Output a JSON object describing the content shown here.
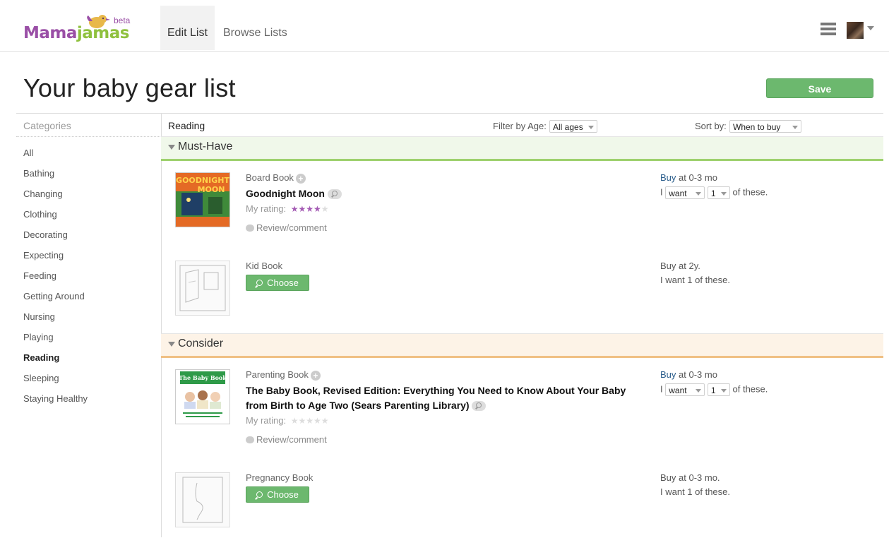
{
  "header": {
    "logo_text_a": "Mama",
    "logo_text_b": "jamas",
    "beta": "beta",
    "tabs": [
      {
        "label": "Edit List",
        "active": true
      },
      {
        "label": "Browse Lists",
        "active": false
      }
    ],
    "icons": {
      "menu": "hamburger-menu-icon",
      "avatar": "user-avatar",
      "dropdown": "caret-down-icon"
    }
  },
  "page": {
    "title": "Your baby gear list",
    "save_label": "Save"
  },
  "sidebar": {
    "heading": "Categories",
    "items": [
      {
        "label": "All",
        "active": false
      },
      {
        "label": "Bathing",
        "active": false
      },
      {
        "label": "Changing",
        "active": false
      },
      {
        "label": "Clothing",
        "active": false
      },
      {
        "label": "Decorating",
        "active": false
      },
      {
        "label": "Expecting",
        "active": false
      },
      {
        "label": "Feeding",
        "active": false
      },
      {
        "label": "Getting Around",
        "active": false
      },
      {
        "label": "Nursing",
        "active": false
      },
      {
        "label": "Playing",
        "active": false
      },
      {
        "label": "Reading",
        "active": true
      },
      {
        "label": "Sleeping",
        "active": false
      },
      {
        "label": "Staying Healthy",
        "active": false
      }
    ]
  },
  "main": {
    "heading": "Reading",
    "filter": {
      "label": "Filter by Age:",
      "value": "All ages"
    },
    "sort": {
      "label": "Sort by:",
      "value": "When to buy"
    },
    "sections": [
      {
        "label": "Must-Have",
        "items": [
          {
            "type": "Board Book",
            "title": "Goodnight Moon",
            "rating_label": "My rating:",
            "rating": 4,
            "rating_max": 5,
            "review_label": "Review/comment",
            "buy_prefix": "Buy",
            "buy_suffix": " at 0-3 mo",
            "want_prefix": "I",
            "want_value": "want",
            "qty_value": "1",
            "want_suffix": "of these."
          },
          {
            "type": "Kid Book",
            "choose_label": "Choose",
            "buy_text": "Buy at 2y.",
            "want_text": "I want 1 of these."
          }
        ]
      },
      {
        "label": "Consider",
        "items": [
          {
            "type": "Parenting Book",
            "title": "The Baby Book, Revised Edition: Everything You Need to Know About Your Baby from Birth to Age Two (Sears Parenting Library)",
            "cover_title": "The Baby Book",
            "rating_label": "My rating:",
            "rating": 0,
            "rating_max": 5,
            "review_label": "Review/comment",
            "buy_prefix": "Buy",
            "buy_suffix": " at 0-3 mo",
            "want_prefix": "I",
            "want_value": "want",
            "qty_value": "1",
            "want_suffix": "of these."
          },
          {
            "type": "Pregnancy Book",
            "choose_label": "Choose",
            "buy_text": "Buy at 0-3 mo.",
            "want_text": "I want 1 of these."
          }
        ]
      }
    ]
  },
  "colors": {
    "accent_green": "#6cb86e",
    "brand_purple": "#9a4fa6",
    "brand_green": "#8fc13e",
    "star_purple": "#a45bb4"
  }
}
